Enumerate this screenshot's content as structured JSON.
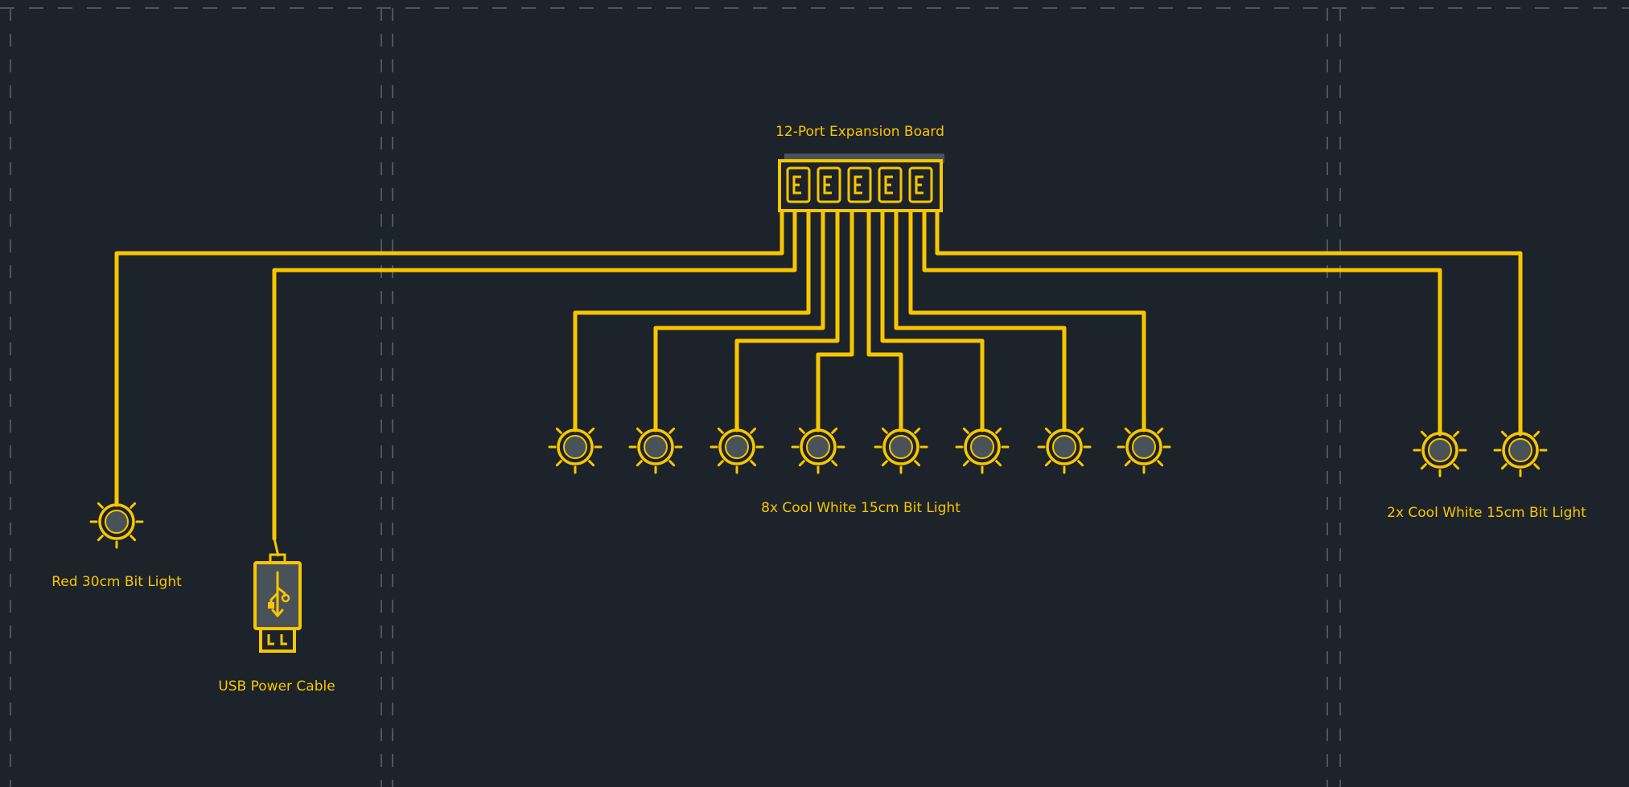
{
  "colors": {
    "background": "#1d232a",
    "wire": "#f8c600",
    "fill": "#4a5259",
    "guide": "#4b5660"
  },
  "labels": {
    "board": "12-Port Expansion Board",
    "red_light": "Red 30cm Bit Light",
    "usb": "USB Power Cable",
    "group8": "8x Cool White 15cm Bit Light",
    "group2": "2x Cool White 15cm Bit Light"
  },
  "icons": {
    "light": "bulb-icon",
    "usb": "usb-icon",
    "port": "port-icon"
  },
  "counts": {
    "board_ports": 5,
    "cool_white_group_a": 8,
    "cool_white_group_b": 2
  }
}
